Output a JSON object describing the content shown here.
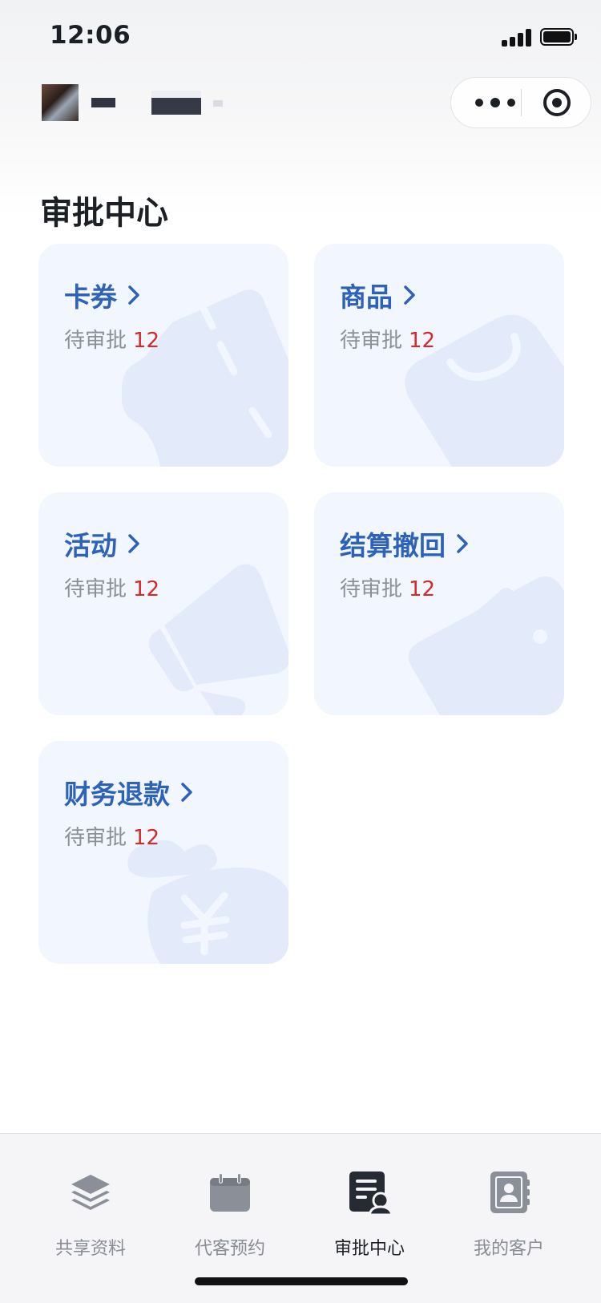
{
  "status_bar": {
    "time": "12:06"
  },
  "page": {
    "title": "审批中心"
  },
  "cards": [
    {
      "title": "卡券",
      "pending_label": "待审批",
      "pending_count": "12",
      "icon": "coupon-icon"
    },
    {
      "title": "商品",
      "pending_label": "待审批",
      "pending_count": "12",
      "icon": "shopping-bag-icon"
    },
    {
      "title": "活动",
      "pending_label": "待审批",
      "pending_count": "12",
      "icon": "megaphone-icon"
    },
    {
      "title": "结算撤回",
      "pending_label": "待审批",
      "pending_count": "12",
      "icon": "wallet-icon"
    },
    {
      "title": "财务退款",
      "pending_label": "待审批",
      "pending_count": "12",
      "icon": "money-bag-icon"
    }
  ],
  "tabbar": {
    "items": [
      {
        "label": "共享资料",
        "icon": "layers-icon",
        "active": false
      },
      {
        "label": "代客预约",
        "icon": "calendar-icon",
        "active": false
      },
      {
        "label": "审批中心",
        "icon": "approval-document-icon",
        "active": true
      },
      {
        "label": "我的客户",
        "icon": "contacts-book-icon",
        "active": false
      }
    ]
  },
  "colors": {
    "accent": "#2d62b8",
    "count_red": "#d32a2a",
    "card_bg": "#f2f6ff",
    "card_watermark": "#e3eaf9",
    "tab_inactive": "#888c94",
    "tab_active": "#1c1f24"
  }
}
